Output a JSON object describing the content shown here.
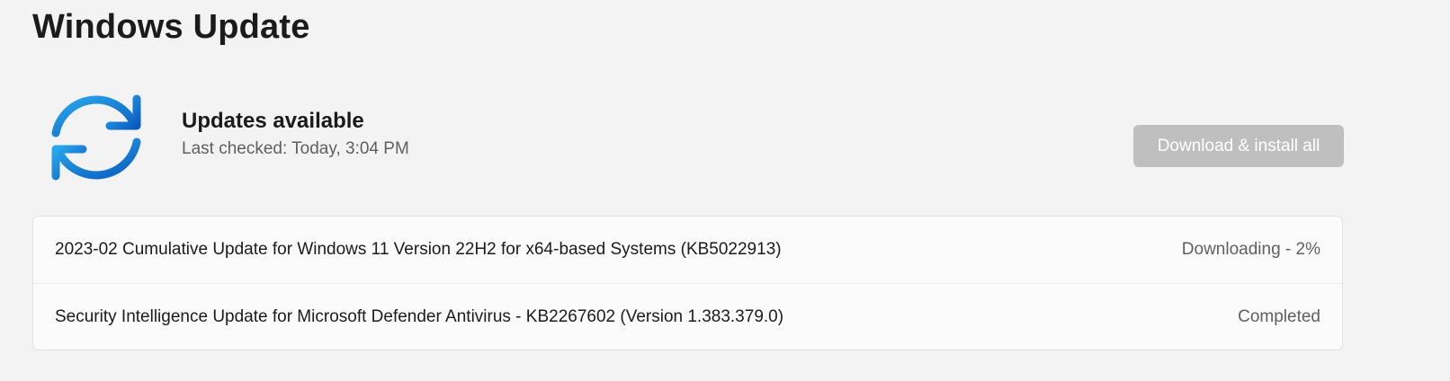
{
  "page": {
    "title": "Windows Update"
  },
  "status": {
    "icon": "sync-icon",
    "heading": "Updates available",
    "last_checked": "Last checked: Today, 3:04 PM",
    "accent_colors": [
      "#29a3e8",
      "#0b5cc0"
    ]
  },
  "actions": {
    "install_all_label": "Download & install all",
    "install_all_enabled": false
  },
  "updates": [
    {
      "name": "2023-02 Cumulative Update for Windows 11 Version 22H2 for x64-based Systems (KB5022913)",
      "status": "Downloading - 2%",
      "progress_percent": 2
    },
    {
      "name": "Security Intelligence Update for Microsoft Defender Antivirus - KB2267602 (Version 1.383.379.0)",
      "status": "Completed"
    }
  ]
}
